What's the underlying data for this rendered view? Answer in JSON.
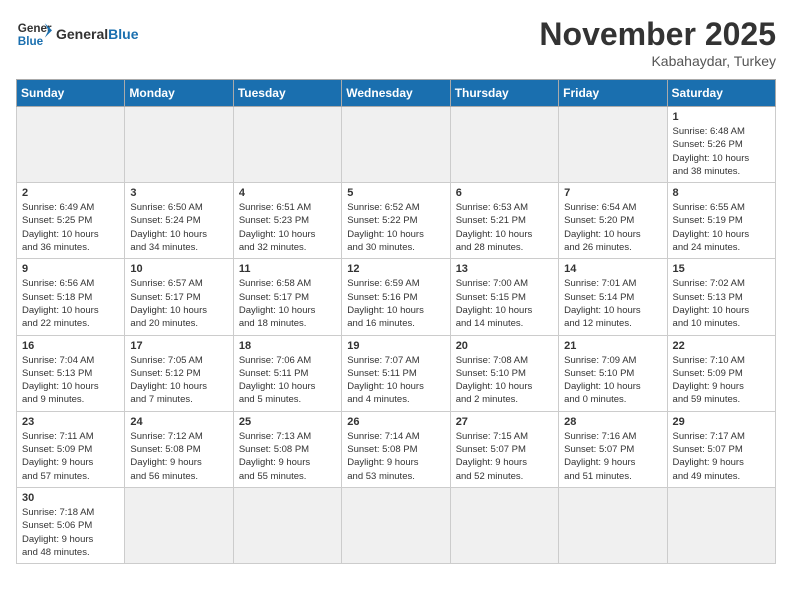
{
  "header": {
    "logo_general": "General",
    "logo_blue": "Blue",
    "month_title": "November 2025",
    "subtitle": "Kabahaydar, Turkey"
  },
  "days_of_week": [
    "Sunday",
    "Monday",
    "Tuesday",
    "Wednesday",
    "Thursday",
    "Friday",
    "Saturday"
  ],
  "weeks": [
    [
      {
        "day": "",
        "info": "",
        "empty": true
      },
      {
        "day": "",
        "info": "",
        "empty": true
      },
      {
        "day": "",
        "info": "",
        "empty": true
      },
      {
        "day": "",
        "info": "",
        "empty": true
      },
      {
        "day": "",
        "info": "",
        "empty": true
      },
      {
        "day": "",
        "info": "",
        "empty": true
      },
      {
        "day": "1",
        "info": "Sunrise: 6:48 AM\nSunset: 5:26 PM\nDaylight: 10 hours\nand 38 minutes.",
        "empty": false
      }
    ],
    [
      {
        "day": "2",
        "info": "Sunrise: 6:49 AM\nSunset: 5:25 PM\nDaylight: 10 hours\nand 36 minutes.",
        "empty": false
      },
      {
        "day": "3",
        "info": "Sunrise: 6:50 AM\nSunset: 5:24 PM\nDaylight: 10 hours\nand 34 minutes.",
        "empty": false
      },
      {
        "day": "4",
        "info": "Sunrise: 6:51 AM\nSunset: 5:23 PM\nDaylight: 10 hours\nand 32 minutes.",
        "empty": false
      },
      {
        "day": "5",
        "info": "Sunrise: 6:52 AM\nSunset: 5:22 PM\nDaylight: 10 hours\nand 30 minutes.",
        "empty": false
      },
      {
        "day": "6",
        "info": "Sunrise: 6:53 AM\nSunset: 5:21 PM\nDaylight: 10 hours\nand 28 minutes.",
        "empty": false
      },
      {
        "day": "7",
        "info": "Sunrise: 6:54 AM\nSunset: 5:20 PM\nDaylight: 10 hours\nand 26 minutes.",
        "empty": false
      },
      {
        "day": "8",
        "info": "Sunrise: 6:55 AM\nSunset: 5:19 PM\nDaylight: 10 hours\nand 24 minutes.",
        "empty": false
      }
    ],
    [
      {
        "day": "9",
        "info": "Sunrise: 6:56 AM\nSunset: 5:18 PM\nDaylight: 10 hours\nand 22 minutes.",
        "empty": false
      },
      {
        "day": "10",
        "info": "Sunrise: 6:57 AM\nSunset: 5:17 PM\nDaylight: 10 hours\nand 20 minutes.",
        "empty": false
      },
      {
        "day": "11",
        "info": "Sunrise: 6:58 AM\nSunset: 5:17 PM\nDaylight: 10 hours\nand 18 minutes.",
        "empty": false
      },
      {
        "day": "12",
        "info": "Sunrise: 6:59 AM\nSunset: 5:16 PM\nDaylight: 10 hours\nand 16 minutes.",
        "empty": false
      },
      {
        "day": "13",
        "info": "Sunrise: 7:00 AM\nSunset: 5:15 PM\nDaylight: 10 hours\nand 14 minutes.",
        "empty": false
      },
      {
        "day": "14",
        "info": "Sunrise: 7:01 AM\nSunset: 5:14 PM\nDaylight: 10 hours\nand 12 minutes.",
        "empty": false
      },
      {
        "day": "15",
        "info": "Sunrise: 7:02 AM\nSunset: 5:13 PM\nDaylight: 10 hours\nand 10 minutes.",
        "empty": false
      }
    ],
    [
      {
        "day": "16",
        "info": "Sunrise: 7:04 AM\nSunset: 5:13 PM\nDaylight: 10 hours\nand 9 minutes.",
        "empty": false
      },
      {
        "day": "17",
        "info": "Sunrise: 7:05 AM\nSunset: 5:12 PM\nDaylight: 10 hours\nand 7 minutes.",
        "empty": false
      },
      {
        "day": "18",
        "info": "Sunrise: 7:06 AM\nSunset: 5:11 PM\nDaylight: 10 hours\nand 5 minutes.",
        "empty": false
      },
      {
        "day": "19",
        "info": "Sunrise: 7:07 AM\nSunset: 5:11 PM\nDaylight: 10 hours\nand 4 minutes.",
        "empty": false
      },
      {
        "day": "20",
        "info": "Sunrise: 7:08 AM\nSunset: 5:10 PM\nDaylight: 10 hours\nand 2 minutes.",
        "empty": false
      },
      {
        "day": "21",
        "info": "Sunrise: 7:09 AM\nSunset: 5:10 PM\nDaylight: 10 hours\nand 0 minutes.",
        "empty": false
      },
      {
        "day": "22",
        "info": "Sunrise: 7:10 AM\nSunset: 5:09 PM\nDaylight: 9 hours\nand 59 minutes.",
        "empty": false
      }
    ],
    [
      {
        "day": "23",
        "info": "Sunrise: 7:11 AM\nSunset: 5:09 PM\nDaylight: 9 hours\nand 57 minutes.",
        "empty": false
      },
      {
        "day": "24",
        "info": "Sunrise: 7:12 AM\nSunset: 5:08 PM\nDaylight: 9 hours\nand 56 minutes.",
        "empty": false
      },
      {
        "day": "25",
        "info": "Sunrise: 7:13 AM\nSunset: 5:08 PM\nDaylight: 9 hours\nand 55 minutes.",
        "empty": false
      },
      {
        "day": "26",
        "info": "Sunrise: 7:14 AM\nSunset: 5:08 PM\nDaylight: 9 hours\nand 53 minutes.",
        "empty": false
      },
      {
        "day": "27",
        "info": "Sunrise: 7:15 AM\nSunset: 5:07 PM\nDaylight: 9 hours\nand 52 minutes.",
        "empty": false
      },
      {
        "day": "28",
        "info": "Sunrise: 7:16 AM\nSunset: 5:07 PM\nDaylight: 9 hours\nand 51 minutes.",
        "empty": false
      },
      {
        "day": "29",
        "info": "Sunrise: 7:17 AM\nSunset: 5:07 PM\nDaylight: 9 hours\nand 49 minutes.",
        "empty": false
      }
    ],
    [
      {
        "day": "30",
        "info": "Sunrise: 7:18 AM\nSunset: 5:06 PM\nDaylight: 9 hours\nand 48 minutes.",
        "empty": false
      },
      {
        "day": "",
        "info": "",
        "empty": true
      },
      {
        "day": "",
        "info": "",
        "empty": true
      },
      {
        "day": "",
        "info": "",
        "empty": true
      },
      {
        "day": "",
        "info": "",
        "empty": true
      },
      {
        "day": "",
        "info": "",
        "empty": true
      },
      {
        "day": "",
        "info": "",
        "empty": true
      }
    ]
  ]
}
